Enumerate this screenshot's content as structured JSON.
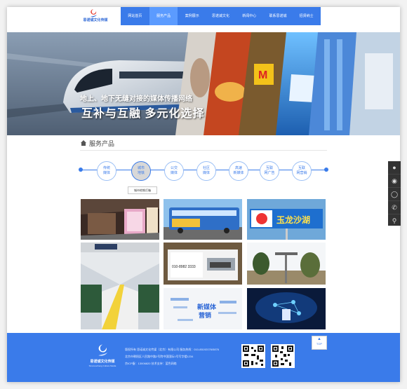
{
  "brand": {
    "name": "思诺诚文化传媒",
    "accent": "#3a7bea"
  },
  "nav": {
    "items": [
      {
        "label": "网站首页",
        "active": false
      },
      {
        "label": "服务产品",
        "active": true
      },
      {
        "label": "案例展示",
        "active": false
      },
      {
        "label": "思诺诚文化",
        "active": false
      },
      {
        "label": "新闻中心",
        "active": false
      },
      {
        "label": "联系思诺诚",
        "active": false
      },
      {
        "label": "招贤纳士",
        "active": false
      }
    ]
  },
  "banner": {
    "line1": "地上、地下无缝对接的媒体传播网络",
    "line2": "互补与互融  多元化选择"
  },
  "section": {
    "title": "服务产品"
  },
  "timeline": {
    "items": [
      {
        "line1": "传统",
        "line2": "媒体",
        "active": false
      },
      {
        "line1": "城市",
        "line2": "地铁",
        "active": true
      },
      {
        "line1": "公交",
        "line2": "媒体",
        "active": false
      },
      {
        "line1": "社区",
        "line2": "媒体",
        "active": false
      },
      {
        "line1": "高速",
        "line2": "新媒体",
        "active": false
      },
      {
        "line1": "互联",
        "line2": "网广告",
        "active": false
      },
      {
        "line1": "互联",
        "line2": "网营销",
        "active": false
      }
    ],
    "active_label": "城市地铁灯箱"
  },
  "grid": {
    "tiles": [
      {
        "icon": "subway-lightbox-image"
      },
      {
        "icon": "bus-ad-image"
      },
      {
        "icon": "billboard-lake-image"
      },
      {
        "icon": "subway-platform-image"
      },
      {
        "icon": "community-poster-image"
      },
      {
        "icon": "bridge-billboard-image"
      },
      {
        "icon": "word-cloud-image"
      },
      {
        "icon": "digital-network-image"
      }
    ],
    "billboard_text": "玉龙沙湖",
    "cloud_words": [
      "新媒体",
      "营销"
    ],
    "phone_text": "010-8982 3333"
  },
  "footer": {
    "logo_sub": "Sinonuocheng Culture Media",
    "line1": "版权所有 思诺诚文化传媒（北京）有限公司 服务热线：010-85192076/5876",
    "line2": "北京市朝阳区人民路中路2号院中国国际1号写字楼1234",
    "line3": "京ICP备：13006820 技术支持：蓝色网络",
    "top_label": "TOP"
  },
  "sidebar": {
    "icons": [
      "wechat-icon",
      "weibo-icon",
      "qq-icon",
      "phone-icon",
      "location-icon"
    ]
  }
}
